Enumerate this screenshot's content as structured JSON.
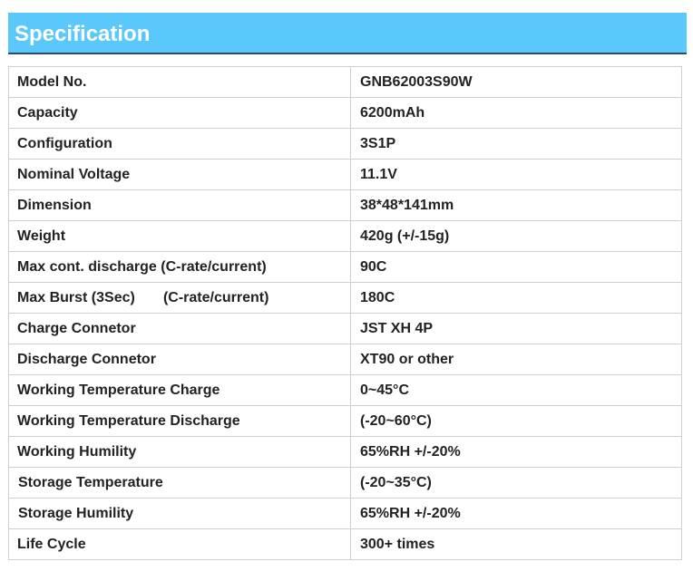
{
  "header": {
    "title": "Specification",
    "accent_color": "#5bc8fb"
  },
  "spec_table": {
    "rows": [
      {
        "label": "Model No.",
        "value": "GNB62003S90W"
      },
      {
        "label": "Capacity",
        "value": "6200mAh"
      },
      {
        "label": "Configuration",
        "value": "3S1P"
      },
      {
        "label": "Nominal Voltage",
        "value": "11.1V"
      },
      {
        "label": "Dimension",
        "value": "38*48*141mm"
      },
      {
        "label": "Weight",
        "value": "420g (+/-15g)"
      },
      {
        "label": "Max cont. discharge (C-rate/current)",
        "value": "90C"
      },
      {
        "label": "Max Burst (3Sec)       (C-rate/current)",
        "value": "180C"
      },
      {
        "label": "Charge Connetor",
        "value": "JST XH 4P"
      },
      {
        "label": "Discharge Connetor",
        "value": "XT90 or other"
      },
      {
        "label": "Working Temperature Charge",
        "value": "0~45°C"
      },
      {
        "label": "Working Temperature Discharge",
        "value": "(-20~60°C)"
      },
      {
        "label": "Working Humility",
        "value": "65%RH +/-20%"
      },
      {
        "label": "Storage Temperature",
        "value": "(-20~35°C)"
      },
      {
        "label": "Storage Humility",
        "value": "65%RH +/-20%"
      },
      {
        "label": "Life Cycle",
        "value": "300+ times"
      }
    ]
  }
}
